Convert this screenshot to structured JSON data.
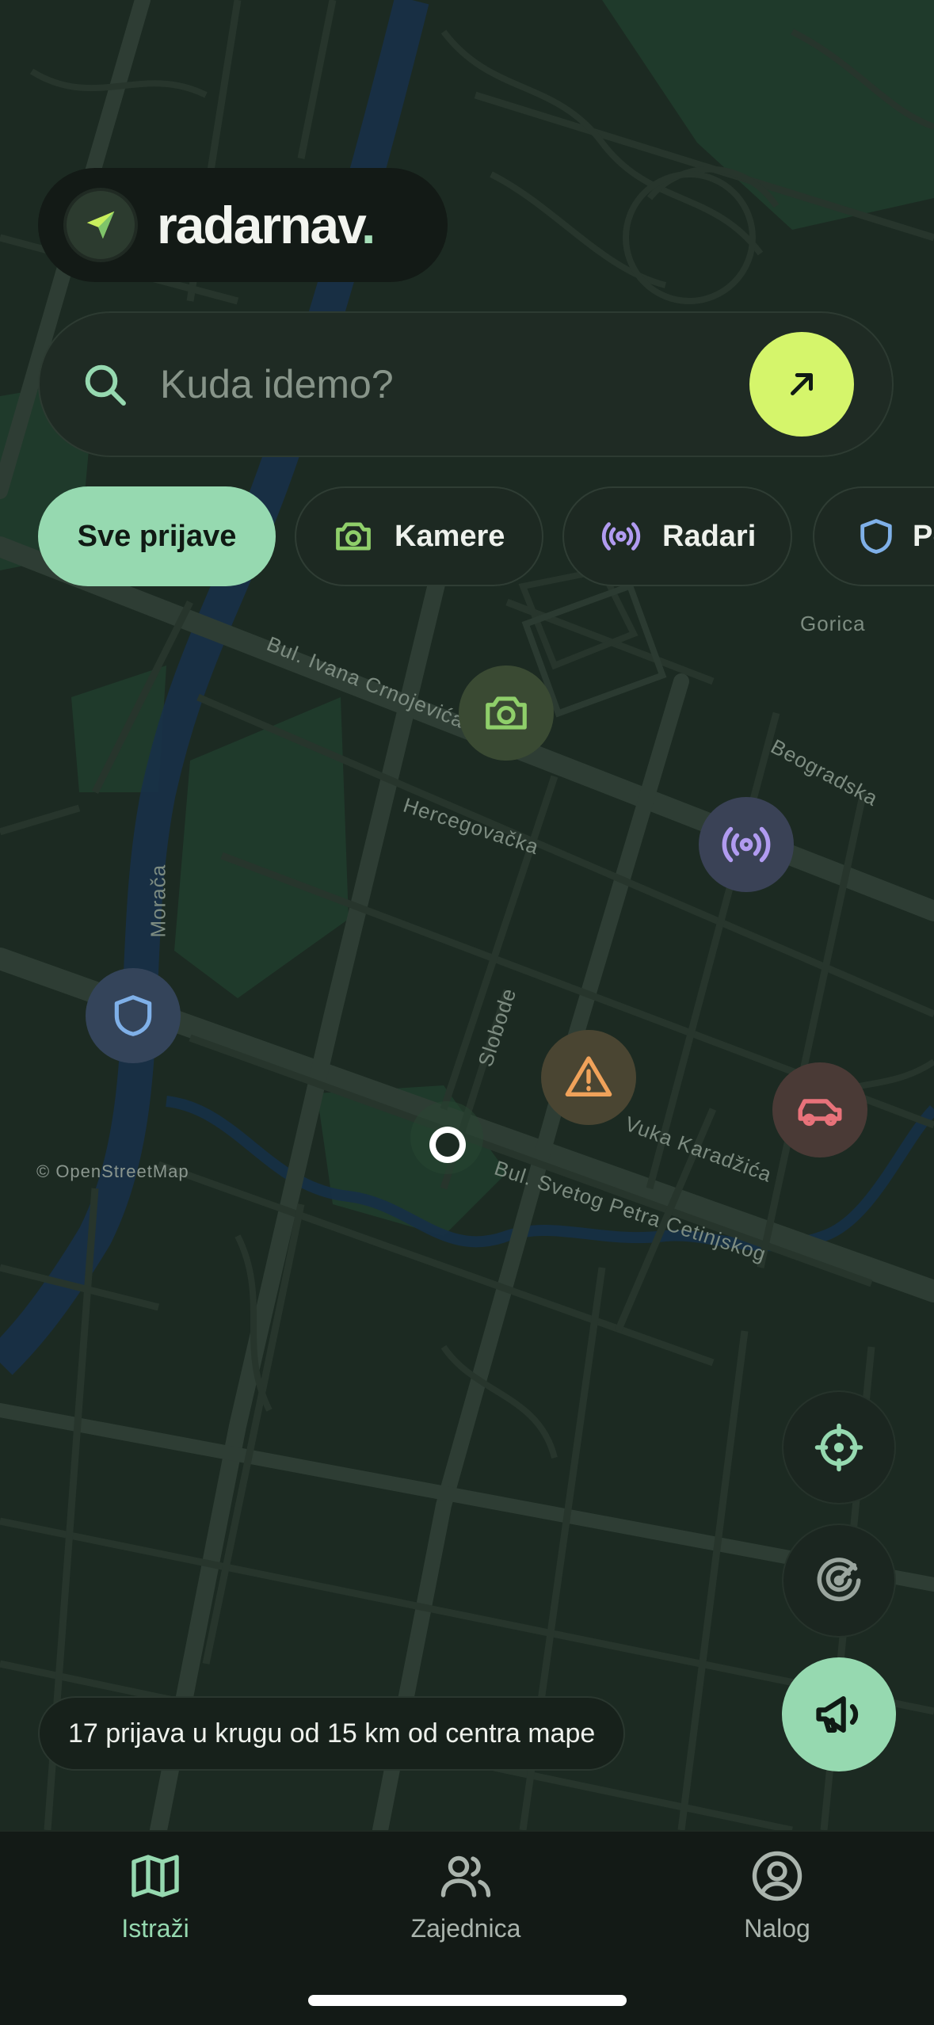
{
  "brand": {
    "name": "radarnav",
    "dot": "."
  },
  "search": {
    "placeholder": "Kuda idemo?"
  },
  "filters": [
    {
      "label": "Sve prijave",
      "active": true
    },
    {
      "label": "Kamere",
      "icon": "camera-icon",
      "color": "#8fcf6a"
    },
    {
      "label": "Radari",
      "icon": "radar-broadcast-icon",
      "color": "#b19bf0"
    },
    {
      "label": "Po",
      "icon": "shield-icon",
      "color": "#7fb0e8"
    }
  ],
  "map": {
    "streets": {
      "ivana": "Bul. Ivana Crnojevića",
      "hercegovacka": "Hercegovačka",
      "beogradska": "Beogradska",
      "moraca": "Morača",
      "slobode": "Slobode",
      "vuka": "Vuka Karadžića",
      "svetog_petra": "Bul. Svetog Petra Cetinjskog",
      "gorica": "Gorica"
    },
    "attribution": "© OpenStreetMap",
    "markers": [
      {
        "type": "camera",
        "icon": "camera-icon",
        "color": "#8fcf6a"
      },
      {
        "type": "radar",
        "icon": "radar-broadcast-icon",
        "color": "#b19bf0"
      },
      {
        "type": "police",
        "icon": "shield-icon",
        "color": "#7fb0e8"
      },
      {
        "type": "hazard",
        "icon": "warning-icon",
        "color": "#f0a25a"
      },
      {
        "type": "accident",
        "icon": "car-icon",
        "color": "#e8727a"
      }
    ]
  },
  "status": {
    "text": "17 prijava u krugu od 15 km od centra mape"
  },
  "nav": [
    {
      "label": "Istraži",
      "icon": "map-icon",
      "active": true
    },
    {
      "label": "Zajednica",
      "icon": "users-icon",
      "active": false
    },
    {
      "label": "Nalog",
      "icon": "account-icon",
      "active": false
    }
  ],
  "colors": {
    "accent": "#96d9b0",
    "go": "#d5f56b",
    "background": "#1c2a22"
  }
}
